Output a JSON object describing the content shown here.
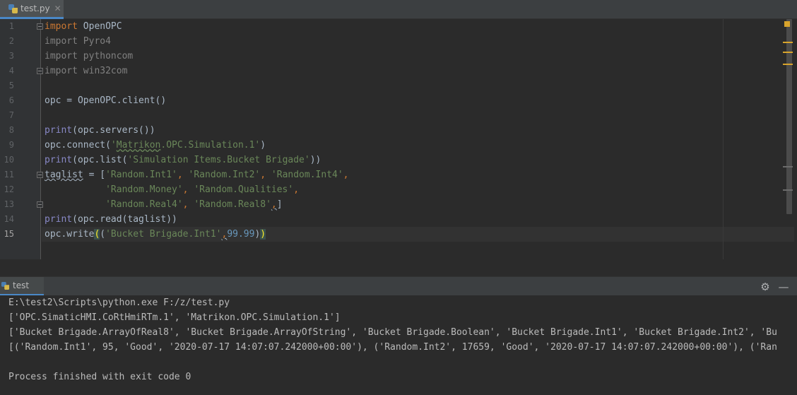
{
  "editor": {
    "tab_label": "test.py",
    "close_glyph": "✕",
    "line_numbers": [
      "1",
      "2",
      "3",
      "4",
      "5",
      "6",
      "7",
      "8",
      "9",
      "10",
      "11",
      "12",
      "13",
      "14",
      "15"
    ],
    "code": {
      "l1_kw": "import",
      "l1_rest": " OpenOPC",
      "l2": "import Pyro4",
      "l3": "import pythoncom",
      "l4": "import win32com",
      "l6": "opc = OpenOPC.client()",
      "l8_fn": "print",
      "l8_rest": "(opc.servers())",
      "l9_a": "opc.connect(",
      "l9_q": "'",
      "l9_str": "Matrikon",
      "l9_str2": ".OPC.Simulation.1'",
      "l9_b": ")",
      "l10_fn": "print",
      "l10_a": "(opc.list(",
      "l10_str": "'Simulation Items.Bucket Brigade'",
      "l10_b": "))",
      "l11_var": "taglist",
      "l11_a": " = [",
      "l11_s1": "'Random.Int1'",
      "l11_c1": ", ",
      "l11_s2": "'Random.Int2'",
      "l11_c2": ", ",
      "l11_s3": "'Random.Int4'",
      "l11_c3": ",",
      "l12_indent": "           ",
      "l12_s1": "'Random.Money'",
      "l12_c1": ", ",
      "l12_s2": "'Random.Qualities'",
      "l12_c2": ",",
      "l13_indent": "           ",
      "l13_s1": "'Random.Real4'",
      "l13_c1": ", ",
      "l13_s2": "'Random.Real8'",
      "l13_c2": ",",
      "l13_b": "]",
      "l14_fn": "print",
      "l14_rest": "(opc.read(taglist))",
      "l15_a": "opc.write",
      "l15_p1": "(",
      "l15_p2": "(",
      "l15_str": "'Bucket Brigade.Int1'",
      "l15_c": ",",
      "l15_num": "99.99",
      "l15_p3": ")",
      "l15_p4": ")"
    },
    "colors": {
      "marker_orange": "#d8a42c",
      "marker_gray": "#6b6b6b"
    }
  },
  "run": {
    "tab_label": "test",
    "settings_icon": "⚙",
    "minimize_icon": "—",
    "output": [
      "E:\\test2\\Scripts\\python.exe F:/z/test.py",
      "['OPC.SimaticHMI.CoRtHmiRTm.1', 'Matrikon.OPC.Simulation.1']",
      "['Bucket Brigade.ArrayOfReal8', 'Bucket Brigade.ArrayOfString', 'Bucket Brigade.Boolean', 'Bucket Brigade.Int1', 'Bucket Brigade.Int2', 'Bu",
      "[('Random.Int1', 95, 'Good', '2020-07-17 14:07:07.242000+00:00'), ('Random.Int2', 17659, 'Good', '2020-07-17 14:07:07.242000+00:00'), ('Ran",
      "",
      "Process finished with exit code 0"
    ]
  }
}
